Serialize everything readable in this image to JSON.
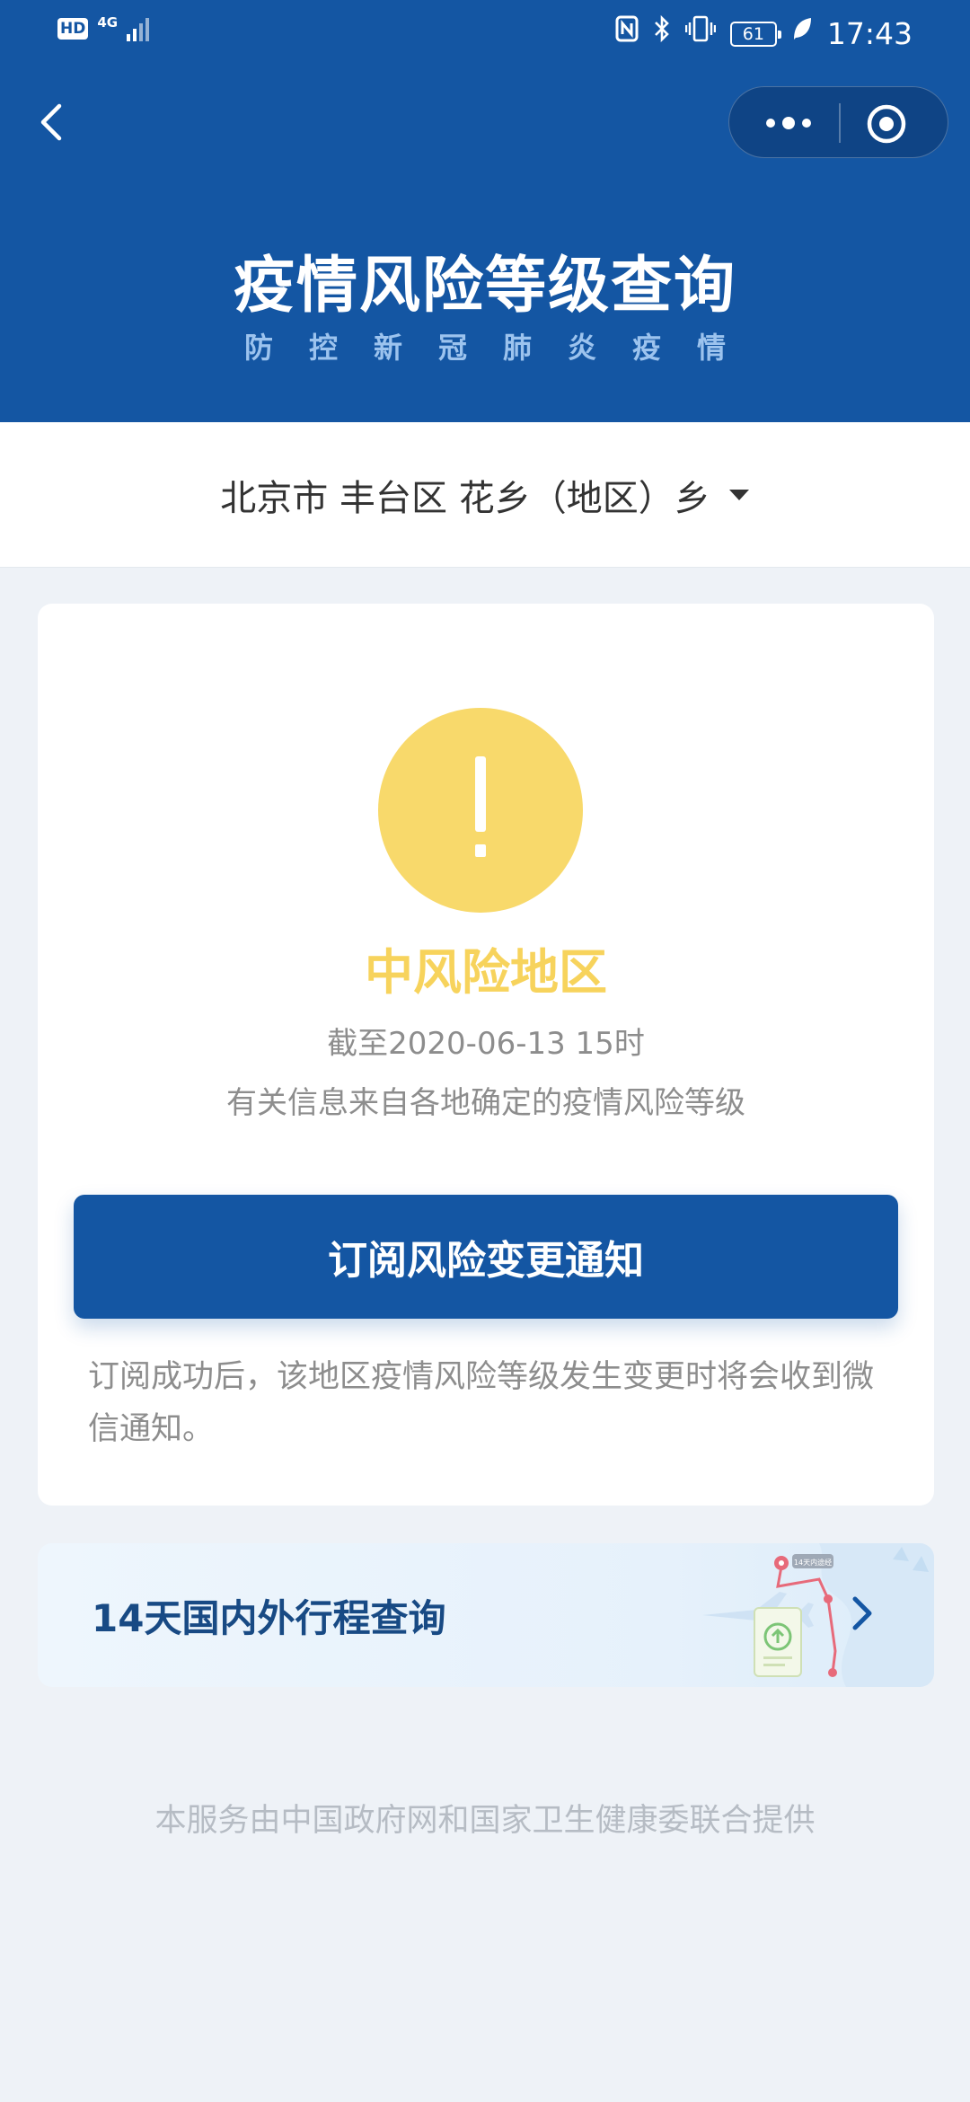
{
  "status_bar": {
    "hd": "HD",
    "network": "4G",
    "battery": "61",
    "time": "17:43"
  },
  "header": {
    "title": "疫情风险等级查询",
    "subtitle": "防控新冠肺炎疫情"
  },
  "location": {
    "text": "北京市 丰台区 花乡（地区）乡"
  },
  "risk_card": {
    "level": "中风险地区",
    "updated": "截至2020-06-13 15时",
    "source": "有关信息来自各地确定的疫情风险等级",
    "subscribe_label": "订阅风险变更通知",
    "subscribe_note": "订阅成功后，该地区疫情风险等级发生变更时将会收到微信通知。",
    "level_color": "#f7d35c"
  },
  "itinerary": {
    "label": "14天国内外行程查询",
    "map_badge": "14天内途经"
  },
  "footer": {
    "note": "本服务由中国政府网和国家卫生健康委联合提供"
  },
  "colors": {
    "brand": "#1456a3",
    "warning": "#f8d96b",
    "background": "#eef2f7"
  }
}
